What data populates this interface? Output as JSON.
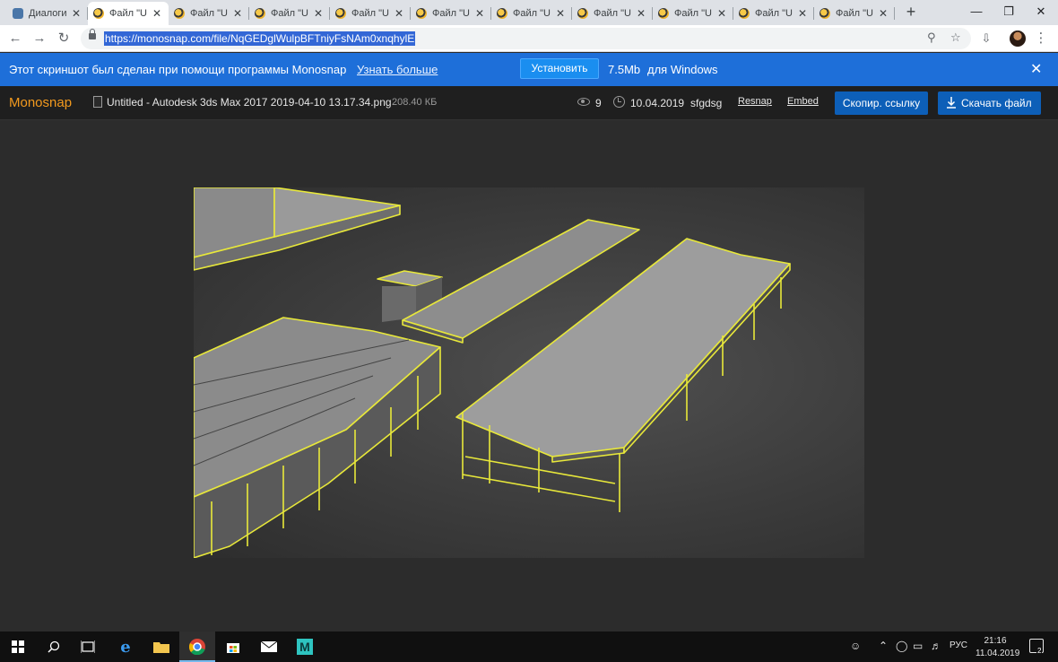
{
  "browser": {
    "tabs": [
      {
        "label": "Диалоги",
        "icon": "vk-icon"
      },
      {
        "label": "Файл \"U",
        "icon": "monosnap-icon",
        "active": true
      },
      {
        "label": "Файл \"U",
        "icon": "monosnap-icon"
      },
      {
        "label": "Файл \"U",
        "icon": "monosnap-icon"
      },
      {
        "label": "Файл \"U",
        "icon": "monosnap-icon"
      },
      {
        "label": "Файл \"U",
        "icon": "monosnap-icon"
      },
      {
        "label": "Файл \"U",
        "icon": "monosnap-icon"
      },
      {
        "label": "Файл \"U",
        "icon": "monosnap-icon"
      },
      {
        "label": "Файл \"U",
        "icon": "monosnap-icon"
      },
      {
        "label": "Файл \"U",
        "icon": "monosnap-icon"
      },
      {
        "label": "Файл \"U",
        "icon": "monosnap-icon"
      }
    ],
    "url": "https://monosnap.com/file/NqGEDglWulpBFTniyFsNAm0xnqhylE"
  },
  "banner": {
    "text": "Этот скриншот был сделан при помощи программы Monosnap",
    "link": "Узнать больше",
    "install": "Установить",
    "size": "7.5Mb",
    "os": "для Windows"
  },
  "monosnap": {
    "logo": "Monosnap",
    "filename": "Untitled - Autodesk 3ds Max 2017 2019-04-10 13.17.34.png",
    "filesize": "208.40 КБ",
    "views": "9",
    "date": "10.04.2019",
    "user": "sfgdsg",
    "resnap": "Resnap",
    "embed": "Embed",
    "copy_link": "Скопир. ссылку",
    "download": "Скачать файл"
  },
  "taskbar": {
    "lang": "РУС",
    "time": "21:16",
    "date": "11.04.2019",
    "notifications": "2"
  }
}
